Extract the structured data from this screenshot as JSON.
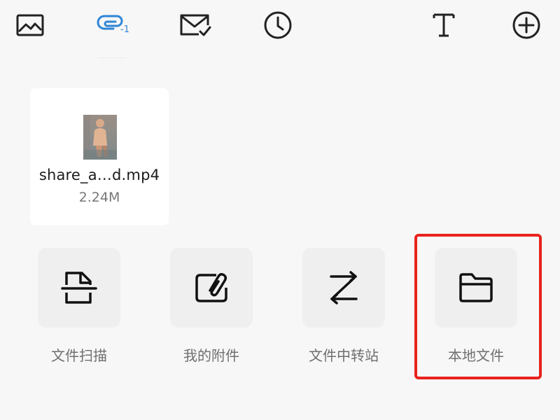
{
  "toolbar": {
    "tools": [
      {
        "name": "image-tool",
        "icon": "image-icon"
      },
      {
        "name": "attachment-tool",
        "icon": "attachment-icon",
        "badge": "-1",
        "active": true
      },
      {
        "name": "mail-tool",
        "icon": "mail-check-icon"
      },
      {
        "name": "schedule-tool",
        "icon": "clock-icon"
      },
      {
        "name": "text-format-tool",
        "icon": "text-format-icon"
      },
      {
        "name": "add-tool",
        "icon": "plus-circle-icon"
      }
    ],
    "accent_color": "#2f86d6"
  },
  "attachment": {
    "file_name": "share_a…d.mp4",
    "file_size": "2.24M",
    "thumbnail": "video-thumbnail"
  },
  "actions": [
    {
      "label": "文件扫描",
      "icon": "document-scan-icon"
    },
    {
      "label": "我的附件",
      "icon": "attachment-folder-icon"
    },
    {
      "label": "文件中转站",
      "icon": "transfer-icon"
    },
    {
      "label": "本地文件",
      "icon": "folder-icon",
      "highlighted": true
    }
  ],
  "highlight_color": "#e8231c"
}
